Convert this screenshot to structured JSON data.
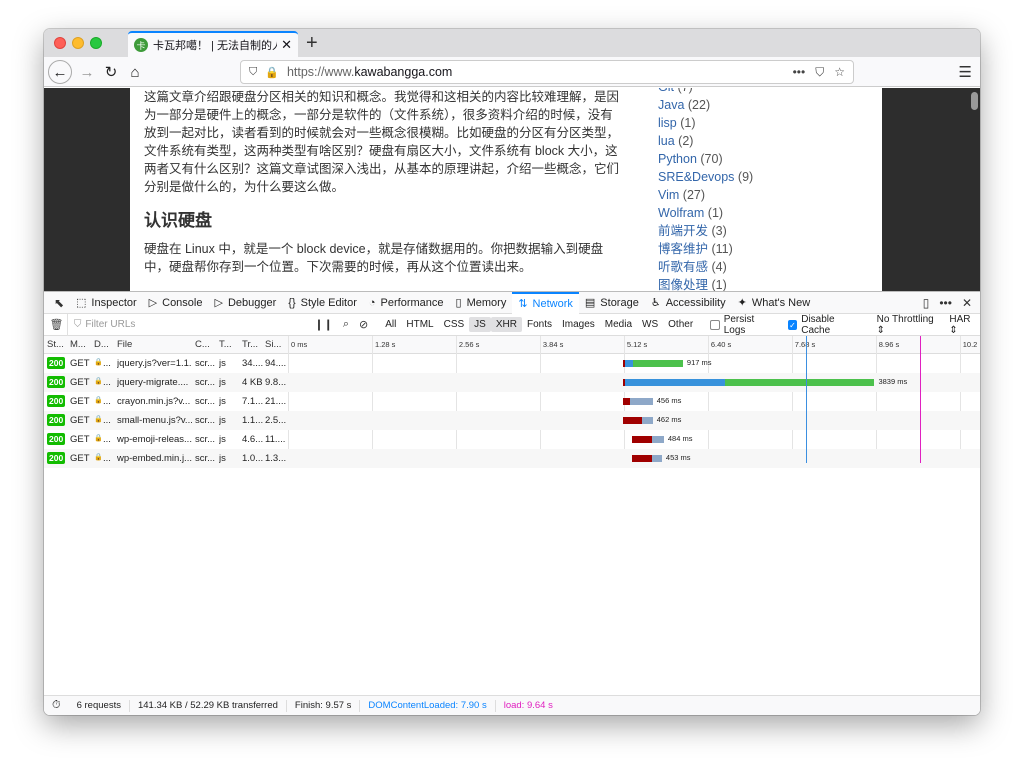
{
  "tab": {
    "title": "卡瓦邦噶！ | 无法自制的人得不到自由",
    "favicon": "卡"
  },
  "nav": {
    "url_prefix": "https://www.",
    "url_domain": "kawabangga.com"
  },
  "article": {
    "p1": "这篇文章介绍跟硬盘分区相关的知识和概念。我觉得和这相关的内容比较难理解，是因为一部分是硬件上的概念，一部分是软件的（文件系统），很多资料介绍的时候，没有放到一起对比，读者看到的时候就会对一些概念很模糊。比如硬盘的分区有分区类型，文件系统有类型，这两种类型有啥区别？硬盘有扇区大小，文件系统有 block 大小，这两者又有什么区别？这篇文章试图深入浅出，从基本的原理讲起，介绍一些概念，它们分别是做什么的，为什么要这么做。",
    "heading": "认识硬盘",
    "p2": "硬盘在 Linux 中，就是一个 block device，就是存储数据用的。你把数据输入到硬盘中，硬盘帮你存到一个位置。下次需要的时候，再从这个位置读出来。"
  },
  "categories": [
    {
      "name": "Git",
      "count": "(7)"
    },
    {
      "name": "Java",
      "count": "(22)"
    },
    {
      "name": "lisp",
      "count": "(1)"
    },
    {
      "name": "lua",
      "count": "(2)"
    },
    {
      "name": "Python",
      "count": "(70)"
    },
    {
      "name": "SRE&Devops",
      "count": "(9)"
    },
    {
      "name": "Vim",
      "count": "(27)"
    },
    {
      "name": "Wolfram",
      "count": "(1)"
    },
    {
      "name": "前端开发",
      "count": "(3)"
    },
    {
      "name": "博客维护",
      "count": "(11)"
    },
    {
      "name": "听歌有感",
      "count": "(4)"
    },
    {
      "name": "图像处理",
      "count": "(1)"
    }
  ],
  "devtools": {
    "tabs": [
      "Inspector",
      "Console",
      "Debugger",
      "Style Editor",
      "Performance",
      "Memory",
      "Network",
      "Storage",
      "Accessibility",
      "What's New"
    ],
    "filter_placeholder": "Filter URLs",
    "types": [
      "All",
      "HTML",
      "CSS",
      "JS",
      "XHR",
      "Fonts",
      "Images",
      "Media",
      "WS",
      "Other"
    ],
    "persist_logs": "Persist Logs",
    "disable_cache": "Disable Cache",
    "throttling": "No Throttling ⇕",
    "har": "HAR ⇕",
    "columns": [
      "St...",
      "M...",
      "D...",
      "File",
      "C...",
      "T...",
      "Tr...",
      "Si..."
    ],
    "ticks": [
      "0 ms",
      "1.28 s",
      "2.56 s",
      "3.84 s",
      "5.12 s",
      "6.40 s",
      "7.68 s",
      "8.96 s",
      "10.2"
    ],
    "requests": [
      {
        "status": "200",
        "method": "GET",
        "file": "jquery.js?ver=1.1...",
        "cause": "scr...",
        "type": "js",
        "transferred": "34....",
        "size": "94....",
        "start": 5.1,
        "blocked": 0.04,
        "wait": 0.12,
        "recv": 0.76,
        "time": "917 ms"
      },
      {
        "status": "200",
        "method": "GET",
        "file": "jquery-migrate....",
        "cause": "scr...",
        "type": "js",
        "transferred": "4 KB",
        "size": "9.8...",
        "start": 5.1,
        "blocked": 0.04,
        "wait": 1.52,
        "recv": 2.28,
        "time": "3839 ms"
      },
      {
        "status": "200",
        "method": "GET",
        "file": "crayon.min.js?v...",
        "cause": "scr...",
        "type": "js",
        "transferred": "7.1...",
        "size": "21....",
        "start": 5.1,
        "blocked": 0.12,
        "wait": 0.34,
        "recv": 0.0,
        "time": "456 ms"
      },
      {
        "status": "200",
        "method": "GET",
        "file": "small-menu.js?v...",
        "cause": "scr...",
        "type": "js",
        "transferred": "1.1...",
        "size": "2.5...",
        "start": 5.1,
        "blocked": 0.3,
        "wait": 0.16,
        "recv": 0.0,
        "time": "462 ms"
      },
      {
        "status": "200",
        "method": "GET",
        "file": "wp-emoji-releas...",
        "cause": "scr...",
        "type": "js",
        "transferred": "4.6...",
        "size": "11....",
        "start": 5.25,
        "blocked": 0.3,
        "wait": 0.18,
        "recv": 0.0,
        "time": "484 ms"
      },
      {
        "status": "200",
        "method": "GET",
        "file": "wp-embed.min.j...",
        "cause": "scr...",
        "type": "js",
        "transferred": "1.0...",
        "size": "1.3...",
        "start": 5.25,
        "blocked": 0.3,
        "wait": 0.15,
        "recv": 0.0,
        "time": "453 ms"
      }
    ],
    "dom_content_loaded_s": 7.9,
    "load_s": 9.64,
    "summary": {
      "requests": "6 requests",
      "size": "141.34 KB / 52.29 KB transferred",
      "finish": "Finish: 9.57 s",
      "dcl": "DOMContentLoaded: 7.90 s",
      "load": "load: 9.64 s"
    }
  }
}
